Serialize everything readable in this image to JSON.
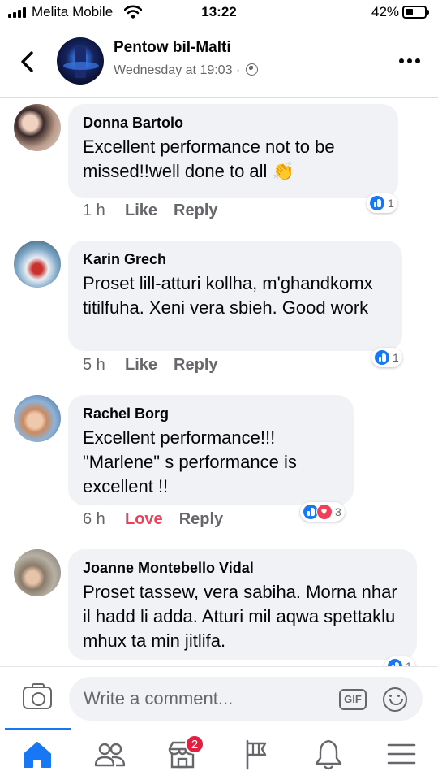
{
  "status_bar": {
    "carrier": "Melita Mobile",
    "time": "13:22",
    "battery_percent": "42%",
    "battery_level": 0.42,
    "signal_bars": 4,
    "wifi_icon": "wifi-icon"
  },
  "header": {
    "group_name": "Pentow bil-Malti",
    "post_time": "Wednesday at 19:03 ·",
    "back_icon": "chevron-left-icon",
    "more_icon": "more-horizontal-icon",
    "privacy_icon": "globe-icon"
  },
  "comments": [
    {
      "author": "Donna Bartolo",
      "text": "Excellent performance not to be missed!!well done to all 👏",
      "time": "1 h",
      "like_label": "Like",
      "reply_label": "Reply",
      "reactions": [
        "like"
      ],
      "reaction_count": "1"
    },
    {
      "author": "Karin Grech",
      "text": "Proset lill-atturi kollha, m'ghandkomx titilfuha. Xeni vera sbieh. Good work",
      "time": "5 h",
      "like_label": "Like",
      "reply_label": "Reply",
      "reactions": [
        "like"
      ],
      "reaction_count": "1"
    },
    {
      "author": "Rachel Borg",
      "text": "Excellent performance!!! \"Marlene\" s performance is excellent !!",
      "time": "6 h",
      "like_label": "Love",
      "reply_label": "Reply",
      "reactions": [
        "like",
        "love"
      ],
      "reaction_count": "3"
    },
    {
      "author": "Joanne Montebello Vidal",
      "text": "Proset tassew, vera sabiha. Morna nhar  il hadd li adda. Atturi mil aqwa spettaklu mhux ta min jitlifa.",
      "time": "",
      "like_label": "",
      "reply_label": "",
      "reactions": [
        "like"
      ],
      "reaction_count": "1"
    }
  ],
  "composer": {
    "placeholder": "Write a comment...",
    "camera_icon": "camera-icon",
    "gif_label": "GIF",
    "emoji_icon": "emoji-icon"
  },
  "bottom_nav": {
    "items": [
      "home-icon",
      "friends-icon",
      "marketplace-icon",
      "pages-icon",
      "notifications-icon",
      "menu-icon"
    ],
    "active": "home-icon",
    "marketplace_badge": "2"
  },
  "colors": {
    "accent": "#1877f2",
    "love": "#f33e58",
    "bubble": "#f0f2f5",
    "muted_text": "#65676b",
    "badge": "#e41e3f"
  }
}
